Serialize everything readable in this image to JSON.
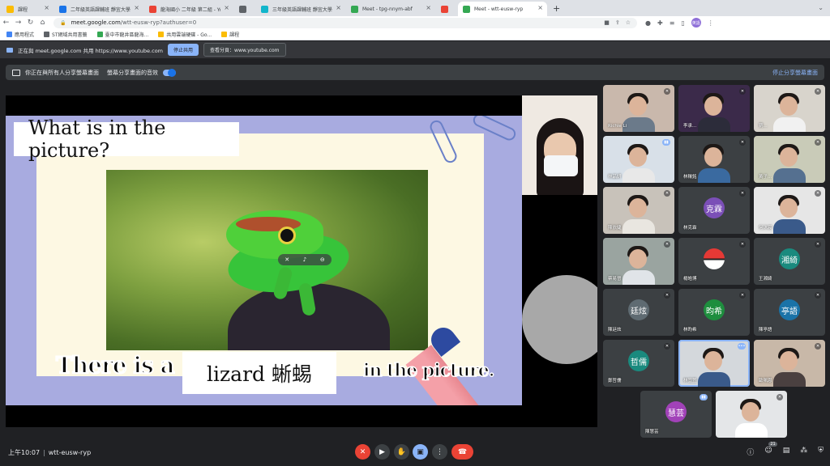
{
  "browser": {
    "tabs": [
      {
        "label": "課程",
        "fav": "#fbbc04"
      },
      {
        "label": "二年級英語課輔班 靜宜大學英語系",
        "fav": "#1a73e8"
      },
      {
        "label": "龍海國小 二年級 第二組 - Yo",
        "fav": "#ea4335"
      },
      {
        "label": "",
        "fav": "#5f6368"
      },
      {
        "label": "三年級英語課輔班 靜宜大學英語系",
        "fav": "#12b5cb"
      },
      {
        "label": "Meet - tpg-nnym-abf",
        "fav": "#34a853"
      },
      {
        "label": "",
        "fav": "#ea4335"
      },
      {
        "label": "Meet - wtt-eusw-ryp",
        "fav": "#34a853"
      }
    ],
    "new_tab": "+",
    "url_host": "meet.google.com",
    "url_path": "/wtt-eusw-ryp?authuser=0",
    "profile_initials": "英語"
  },
  "bookmarks": [
    {
      "label": "應用程式",
      "color": "#4285f4"
    },
    {
      "label": "ST網域共用書籤",
      "color": "#5f6368"
    },
    {
      "label": "臺中市龍井區龍海...",
      "color": "#34a853"
    },
    {
      "label": "共用雲端硬碟 - Go...",
      "color": "#fbbc04"
    },
    {
      "label": "課程",
      "color": "#fbbc04"
    }
  ],
  "share_banner": {
    "text": "正在與 meet.google.com 共用 https://www.youtube.com",
    "stop_label": "停止共用",
    "hide_label": "查看分頁：www.youtube.com"
  },
  "present_bar": {
    "sharing_text": "你正在與所有人分享螢幕畫面",
    "audio_text": "螢幕分享畫面的音效",
    "stop_label": "停止分享螢幕畫面"
  },
  "slide": {
    "title": "What is in the picture?",
    "sentence_start": "There is a",
    "answer": "lizard 蜥蜴",
    "sentence_end": "in the picture."
  },
  "participants": [
    {
      "name": "Richie Li",
      "type": "video",
      "mic": "muted",
      "bg": "#c9b8ac",
      "body": "#6b7a8a"
    },
    {
      "name": "李承...",
      "type": "video",
      "mic": "muted",
      "bg": "#3b2a4a",
      "body": "#2c2c3a"
    },
    {
      "name": "劉...",
      "type": "video",
      "mic": "muted",
      "bg": "#d8d4cc",
      "body": "#f1f1f1"
    },
    {
      "name": "林品妍",
      "type": "video",
      "mic": "talking",
      "bg": "#d8e0e8",
      "body": "#e8e8e8"
    },
    {
      "name": "林穰銘",
      "type": "video",
      "mic": "muted",
      "bg": "#3c4043",
      "body": "#3a6aa0"
    },
    {
      "name": "黃子...",
      "type": "video",
      "mic": "muted",
      "bg": "#c9cbb8",
      "body": "#557090"
    },
    {
      "name": "陳依婕",
      "type": "video",
      "mic": "muted",
      "bg": "#c8c2ba",
      "body": "#e9e6e0"
    },
    {
      "name": "林克霖",
      "type": "avatar",
      "mic": "muted",
      "initials": "克霖",
      "color": "#7b4fb7"
    },
    {
      "name": "何沐宸",
      "type": "video",
      "mic": "muted",
      "bg": "#e6e6e6",
      "body": "#3a5a8a"
    },
    {
      "name": "蔡易晉",
      "type": "video",
      "mic": "muted",
      "bg": "#9aa4a0",
      "body": "#e0e4e8"
    },
    {
      "name": "楊皓博",
      "type": "icon",
      "mic": "muted"
    },
    {
      "name": "王湘綺",
      "type": "avatar",
      "mic": "muted",
      "initials": "湘綺",
      "color": "#1a8a7e"
    },
    {
      "name": "陳廷炫",
      "type": "avatar",
      "mic": "muted",
      "initials": "廷炫",
      "color": "#5f6b72"
    },
    {
      "name": "林昀希",
      "type": "avatar",
      "mic": "muted",
      "initials": "昀希",
      "color": "#1e8e3e"
    },
    {
      "name": "陳亭語",
      "type": "avatar",
      "mic": "muted",
      "initials": "亭語",
      "color": "#1a73a8"
    },
    {
      "name": "鄭哲儒",
      "type": "avatar",
      "mic": "muted",
      "initials": "哲儒",
      "color": "#1a8a7e"
    },
    {
      "name": "林宜萱",
      "type": "video",
      "mic": "more",
      "bg": "#d4d8dc",
      "body": "#3a5a8a"
    },
    {
      "name": "歐珮恩",
      "type": "video",
      "mic": "muted",
      "bg": "#c8b8a8",
      "body": "#4a4040"
    },
    {
      "name": "陳慧芸",
      "type": "avatar",
      "mic": "talking",
      "initials": "慧芸",
      "color": "#a142b8"
    },
    {
      "name": "",
      "type": "video",
      "mic": "muted",
      "bg": "#e4e6e8",
      "body": "#ffffff"
    }
  ],
  "bottom": {
    "time": "上午10:07",
    "meeting_code": "wtt-eusw-ryp",
    "people_count": "21"
  }
}
